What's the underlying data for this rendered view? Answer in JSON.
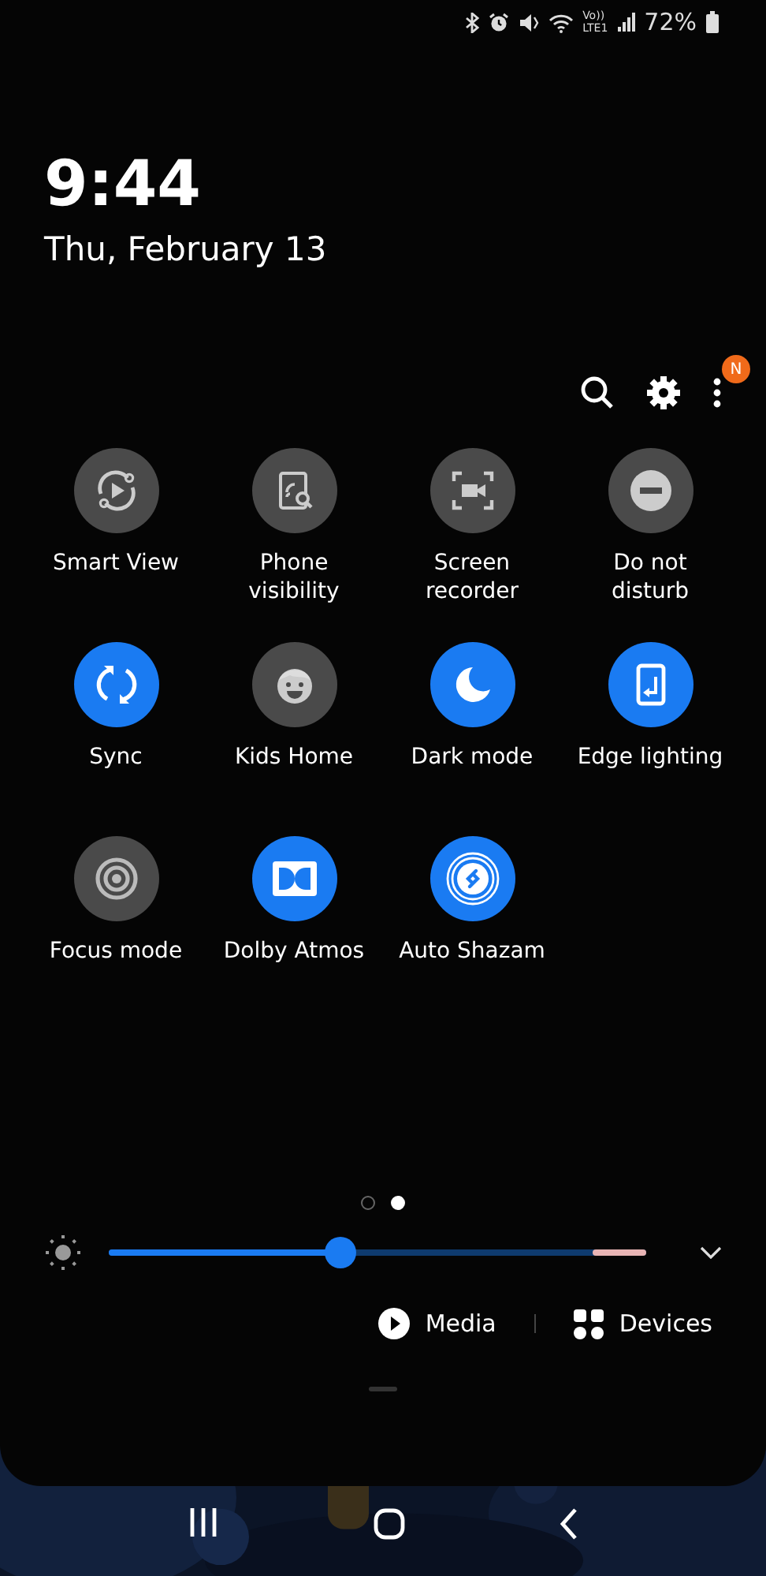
{
  "status_bar": {
    "battery": "72%",
    "network": "LTE1",
    "volte": "Vo))"
  },
  "clock": {
    "time": "9:44",
    "date": "Thu, February 13"
  },
  "toolbar": {
    "badge": "N"
  },
  "tiles": [
    {
      "label": "Smart View",
      "kind": "smart-view",
      "on": false
    },
    {
      "label": "Phone visibility",
      "kind": "visibility",
      "on": false
    },
    {
      "label": "Screen recorder",
      "kind": "recorder",
      "on": false
    },
    {
      "label": "Do not disturb",
      "kind": "dnd",
      "on": false
    },
    {
      "label": "Sync",
      "kind": "sync",
      "on": true
    },
    {
      "label": "Kids Home",
      "kind": "kids",
      "on": false
    },
    {
      "label": "Dark mode",
      "kind": "dark",
      "on": true
    },
    {
      "label": "Edge lighting",
      "kind": "edge",
      "on": true
    },
    {
      "label": "Focus mode",
      "kind": "focus",
      "on": false
    },
    {
      "label": "Dolby Atmos",
      "kind": "dolby",
      "on": true
    },
    {
      "label": "Auto Shazam",
      "kind": "shazam",
      "on": true
    }
  ],
  "pages": [
    {
      "selected": false
    },
    {
      "selected": true
    }
  ],
  "brightness": {
    "level": 0.43
  },
  "actions": [
    {
      "label": "Media",
      "kind": "media"
    },
    {
      "label": "Devices",
      "kind": "devices"
    }
  ]
}
